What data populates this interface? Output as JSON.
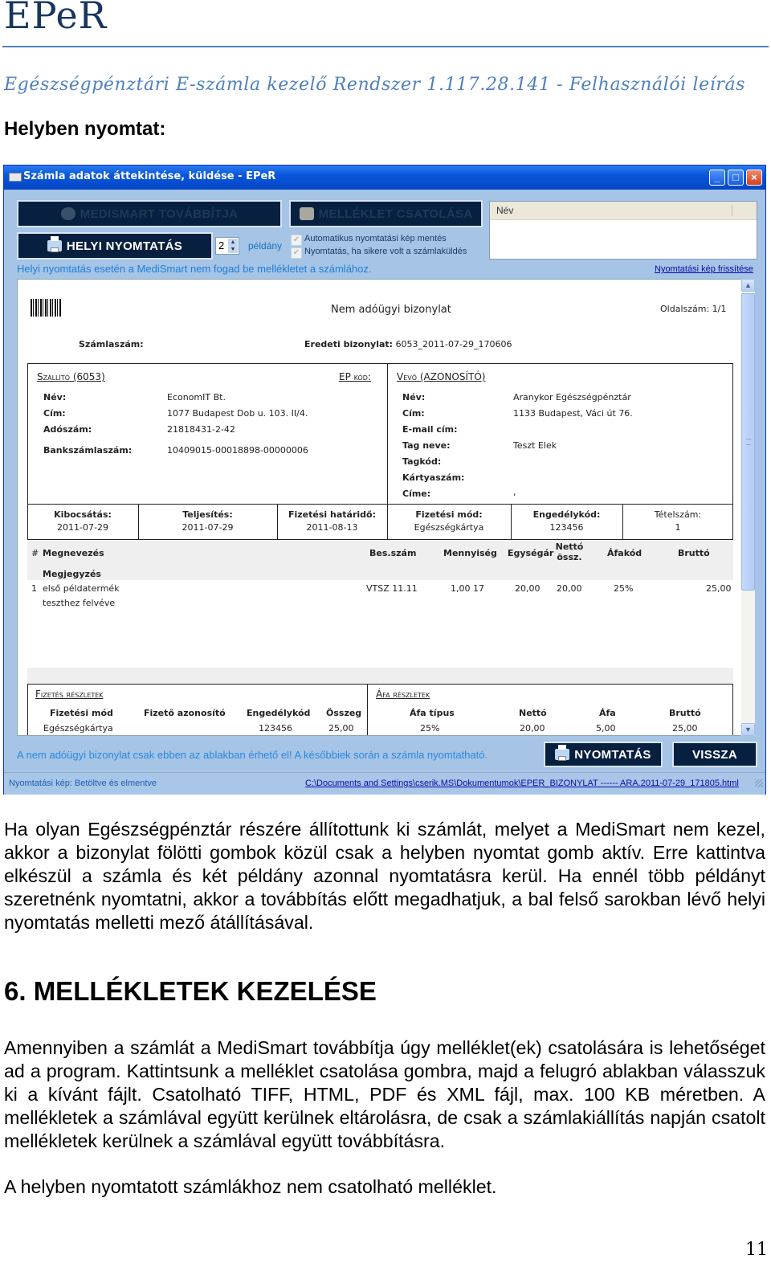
{
  "document": {
    "title": "EPeR",
    "subtitle": "Egészségpénztári E-számla kezelő Rendszer 1.117.28.141 - Felhasználói leírás",
    "section_label": "Helyben nyomtat:",
    "page_number": "11"
  },
  "window": {
    "title": "Számla adatok áttekintése, küldése - EPeR",
    "controls": {
      "minimize": "_",
      "maximize": "□",
      "close": "×"
    },
    "toolbar": {
      "medismart_button": "MEDISMART TOVÁBBÍTJA",
      "attachment_button": "MELLÉKLET CSATOLÁSA",
      "local_print_button": "HELYI NYOMTATÁS",
      "copies_value": "2",
      "copies_label": "példány",
      "checkboxes": [
        {
          "label": "Automatikus nyomtatási kép mentés",
          "checked": true
        },
        {
          "label": "Nyomtatás, ha sikere volt a számlaküldés",
          "checked": true
        }
      ],
      "attachment_list_header": "Név",
      "warning": "Helyi nyomtatás esetén a MediSmart nem fogad be mellékletet a számlához.",
      "refresh_link": "Nyomtatási kép frissítése"
    },
    "invoice": {
      "doc_type": "Nem adóügyi bizonylat",
      "page_label": "Oldalszám:",
      "page_value": "1/1",
      "invoice_no_label": "Számlaszám:",
      "original_doc_label": "Eredeti bizonylat:",
      "original_doc_value": "6053_2011-07-29_170606",
      "supplier": {
        "heading": "Szállító (6053)",
        "ep_code_label": "EP kód:",
        "fields": [
          {
            "label": "Név:",
            "value": "EconomIT Bt."
          },
          {
            "label": "Cím:",
            "value": "1077 Budapest Dob u. 103. II/4."
          },
          {
            "label": "Adószám:",
            "value": "21818431-2-42"
          },
          {
            "label": "Bankszámlaszám:",
            "value": "10409015-00018898-00000006"
          }
        ]
      },
      "buyer": {
        "heading": "Vevő (AZONOSÍTÓ)",
        "fields": [
          {
            "label": "Név:",
            "value": "Aranykor Egészségpénztár"
          },
          {
            "label": "Cím:",
            "value": "1133 Budapest, Váci út 76."
          },
          {
            "label": "E-mail cím:",
            "value": ""
          },
          {
            "label": "Tag neve:",
            "value": "Teszt Elek"
          },
          {
            "label": "Tagkód:",
            "value": ""
          },
          {
            "label": "Kártyaszám:",
            "value": ""
          },
          {
            "label": "Címe:",
            "value": ","
          }
        ]
      },
      "summary": [
        {
          "label": "Kibocsátás:",
          "value": "2011-07-29"
        },
        {
          "label": "Teljesítés:",
          "value": "2011-07-29"
        },
        {
          "label": "Fizetési határidő:",
          "value": "2011-08-13"
        },
        {
          "label": "Fizetési mód:",
          "value": "Egészségkártya"
        },
        {
          "label": "Engedélykód:",
          "value": "123456"
        },
        {
          "label": "Tételszám:",
          "value": "1"
        }
      ],
      "items_header": {
        "num": "#",
        "name": "Megnevezés",
        "note": "Megjegyzés",
        "class_no": "Bes.szám",
        "qty": "Mennyiség",
        "unit_price": "Egységár",
        "net_line1": "Nettó",
        "net_line2": "össz.",
        "vat_code": "Áfakód",
        "gross": "Bruttó"
      },
      "items": [
        {
          "num": "1",
          "name": "első példatermék",
          "note": "teszthez felvéve",
          "class_no": "VTSZ 11.11",
          "qty": "1,00 17",
          "unit_price": "20,00",
          "net": "20,00",
          "vat_code": "25%",
          "gross": "25,00"
        }
      ],
      "payment_details": {
        "heading": "Fizetés részletek",
        "headers": [
          "Fizetési mód",
          "Fizető azonosító",
          "Engedélykód",
          "Összeg"
        ],
        "row": [
          "Egészségkártya",
          "",
          "123456",
          "25,00"
        ]
      },
      "vat_details": {
        "heading": "Áfa részletek",
        "headers": [
          "Áfa típus",
          "Nettó",
          "Áfa",
          "Bruttó"
        ],
        "row": [
          "25%",
          "20,00",
          "5,00",
          "25,00"
        ]
      }
    },
    "bottom": {
      "info": "A nem adóügyi bizonylat csak ebben az ablakban érhető el! A későbbiek során a számla nyomtatható.",
      "print_button": "NYOMTATÁS",
      "back_button": "VISSZA"
    },
    "statusbar": {
      "left": "Nyomtatási kép:  Betöltve és elmentve",
      "path": "C:\\Documents and Settings\\cserik.MS\\Dokumentumok\\EPER_BIZONYLAT ------ ARA.2011-07-29_171805.html"
    }
  },
  "body": {
    "paragraph1": "Ha olyan Egészségpénztár részére állítottunk ki számlát, melyet a MediSmart nem kezel, akkor a bizonylat fölötti gombok közül csak a helyben nyomtat gomb aktív. Erre kattintva elkészül a számla és két példány azonnal nyomtatásra kerül. Ha ennél több példányt szeretnénk nyomtatni, akkor a továbbítás előtt megadhatjuk, a bal felső sarokban lévő helyi nyomtatás melletti mező átállításával.",
    "heading": "6. MELLÉKLETEK KEZELÉSE",
    "paragraph2": "Amennyiben a számlát a MediSmart továbbítja úgy melléklet(ek) csatolására is lehetőséget ad a program. Kattintsunk a melléklet csatolása gombra, majd a felugró ablakban válasszuk ki a kívánt fájlt. Csatolható TIFF, HTML, PDF és XML fájl, max. 100 KB méretben. A mellékletek a számlával együtt kerülnek eltárolásra, de csak a számlakiállítás napján csatolt mellékletek kerülnek a számlával együtt továbbításra.",
    "paragraph3": "A helyben nyomtatott számlákhoz nem csatolható melléklet."
  }
}
